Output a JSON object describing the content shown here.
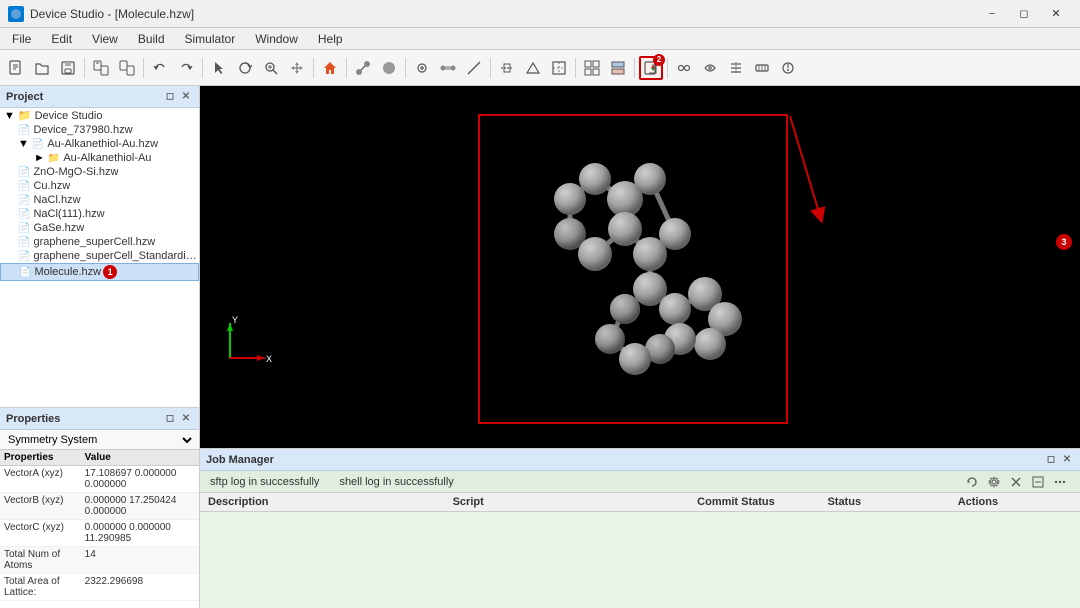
{
  "titlebar": {
    "title": "Device Studio - [Molecule.hzw]",
    "icon": "DS",
    "window_controls": [
      "minimize",
      "restore",
      "close"
    ]
  },
  "menubar": {
    "items": [
      "File",
      "Edit",
      "View",
      "Build",
      "Simulator",
      "Window",
      "Help"
    ]
  },
  "project": {
    "panel_label": "Project",
    "tree": [
      {
        "id": "root",
        "label": "Device Studio",
        "level": 0,
        "icon": "folder",
        "expanded": true,
        "badge": null
      },
      {
        "id": "file1",
        "label": "Device_737980.hzw",
        "level": 1,
        "icon": "file",
        "expanded": false,
        "badge": null
      },
      {
        "id": "folder1",
        "label": "Au-Alkanethiol-Au.hzw",
        "level": 1,
        "icon": "folder",
        "expanded": true,
        "badge": null
      },
      {
        "id": "subfolder1",
        "label": "Au-Alkanethiol-Au",
        "level": 2,
        "icon": "folder",
        "expanded": false,
        "badge": null
      },
      {
        "id": "file2",
        "label": "ZnO-MgO-Si.hzw",
        "level": 1,
        "icon": "file",
        "expanded": false,
        "badge": null
      },
      {
        "id": "file3",
        "label": "Cu.hzw",
        "level": 1,
        "icon": "file",
        "expanded": false,
        "badge": null
      },
      {
        "id": "file4",
        "label": "NaCl.hzw",
        "level": 1,
        "icon": "file",
        "expanded": false,
        "badge": null
      },
      {
        "id": "file5",
        "label": "NaCl(111).hzw",
        "level": 1,
        "icon": "file",
        "expanded": false,
        "badge": null
      },
      {
        "id": "file6",
        "label": "GaSe.hzw",
        "level": 1,
        "icon": "file",
        "expanded": false,
        "badge": null
      },
      {
        "id": "file7",
        "label": "graphene_superCell.hzw",
        "level": 1,
        "icon": "file",
        "expanded": false,
        "badge": null
      },
      {
        "id": "file8",
        "label": "graphene_superCell_StandardizeC...",
        "level": 1,
        "icon": "file",
        "expanded": false,
        "badge": null
      },
      {
        "id": "file9",
        "label": "Molecule.hzw",
        "level": 1,
        "icon": "file-active",
        "expanded": false,
        "badge": "1",
        "selected": true
      }
    ]
  },
  "properties": {
    "panel_label": "Properties",
    "dropdown_label": "Symmetry System",
    "col_properties": "Properties",
    "col_value": "Value",
    "rows": [
      {
        "property": "VectorA (xyz)",
        "value": "17.108697 0.000000\n0.000000"
      },
      {
        "property": "VectorB (xyz)",
        "value": "0.000000 17.250424\n0.000000"
      },
      {
        "property": "VectorC (xyz)",
        "value": "0.000000 0.000000\n11.290985"
      },
      {
        "property": "Total Num of\nAtoms",
        "value": "14"
      },
      {
        "property": "Total Area of\nLattice:",
        "value": "2322.296698"
      }
    ]
  },
  "viewport": {
    "badge2_label": "2",
    "badge3_label": "3",
    "axes": {
      "x_label": "X",
      "y_label": "Y"
    }
  },
  "job_manager": {
    "panel_label": "Job Manager",
    "status_sftp": "sftp log in successfully",
    "status_shell": "shell log in successfully",
    "columns": [
      "Description",
      "Script",
      "Commit Status",
      "Status",
      "Actions"
    ]
  },
  "toolbar": {
    "highlighted_btn": "export"
  },
  "colors": {
    "accent_blue": "#0078d4",
    "selection_red": "#cc0000",
    "atom_gray": "#a0a0a0",
    "bond_gray": "#808080",
    "viewport_bg": "#000000",
    "jm_bg": "#e8f4e8"
  }
}
